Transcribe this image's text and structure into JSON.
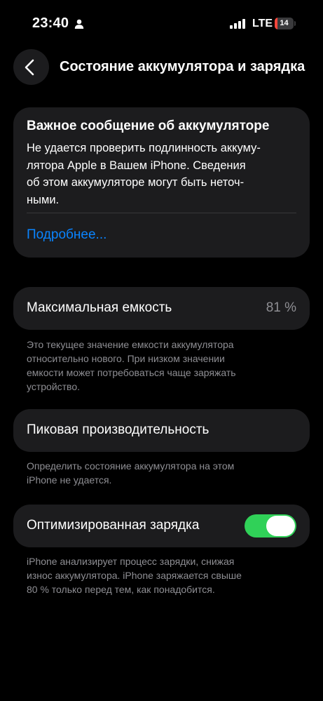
{
  "status_bar": {
    "time": "23:40",
    "network": "LTE",
    "battery_level": "14",
    "battery_fraction": 0.14,
    "battery_color": "#ff453a"
  },
  "nav": {
    "title": "Состояние аккумулятора и зарядка",
    "back_icon": "chevron-left-icon"
  },
  "important_message": {
    "title": "Важное сообщение об аккумуляторе",
    "body_lines": [
      "Не удается проверить подлинность аккуму-",
      "лятора Apple в Вашем iPhone. Сведения",
      "об этом аккумуляторе могут быть неточ-",
      "ными."
    ],
    "link": "Подробнее..."
  },
  "max_capacity": {
    "label": "Максимальная емкость",
    "value": "81 %",
    "footnote_lines": [
      "Это текущее значение емкости аккумулятора",
      "относительно нового. При низком значении",
      "емкости может потребоваться чаще заряжать",
      "устройство."
    ]
  },
  "peak_performance": {
    "label": "Пиковая производительность",
    "footnote_lines": [
      "Определить состояние аккумулятора на этом",
      "iPhone не удается."
    ]
  },
  "optimized_charging": {
    "label": "Оптимизированная зарядка",
    "enabled": true,
    "toggle_color": "#30d158",
    "footnote_lines": [
      "iPhone анализирует процесс зарядки, снижая",
      "износ аккумулятора. iPhone заряжается свыше",
      "80 % только перед тем, как понадобится."
    ]
  },
  "colors": {
    "background": "#000000",
    "card": "#1c1c1e",
    "link": "#0a84ff",
    "secondary_text": "#8e8e93"
  }
}
